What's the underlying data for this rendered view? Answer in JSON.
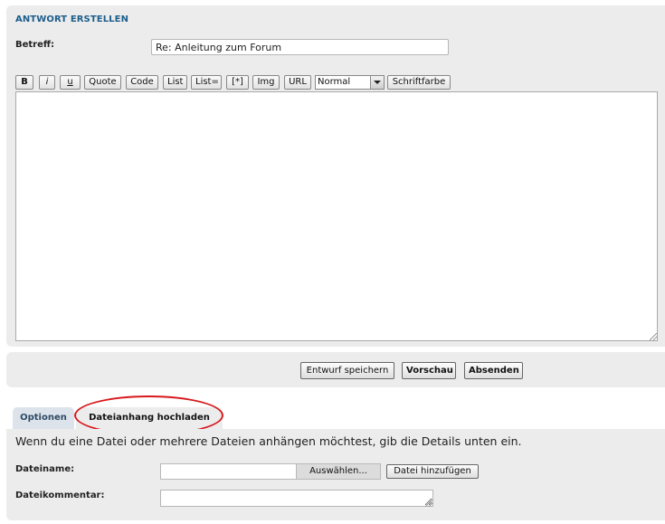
{
  "header": {
    "title": "Antwort erstellen"
  },
  "subject": {
    "label": "Betreff:",
    "value": "Re: Anleitung zum Forum"
  },
  "toolbar": {
    "buttons": [
      "B",
      "i",
      "u",
      "Quote",
      "Code",
      "List",
      "List=",
      "[*]",
      "Img",
      "URL"
    ],
    "size_select": "Normal",
    "color_button": "Schriftfarbe"
  },
  "message": {
    "value": ""
  },
  "actions": {
    "save_draft": "Entwurf speichern",
    "preview": "Vorschau",
    "submit": "Absenden"
  },
  "tabs": [
    {
      "label": "Optionen",
      "active": false
    },
    {
      "label": "Dateianhang hochladen",
      "active": true
    }
  ],
  "attachment": {
    "info": "Wenn du eine Datei oder mehrere Dateien anhängen möchtest, gib die Details unten ein.",
    "filename_label": "Dateiname:",
    "choose_button": "Auswählen...",
    "add_button": "Datei hinzufügen",
    "comment_label": "Dateikommentar:",
    "comment_value": ""
  },
  "colors": {
    "title": "#1c5e8c",
    "panel": "#ececec",
    "highlight": "#d7191c"
  }
}
